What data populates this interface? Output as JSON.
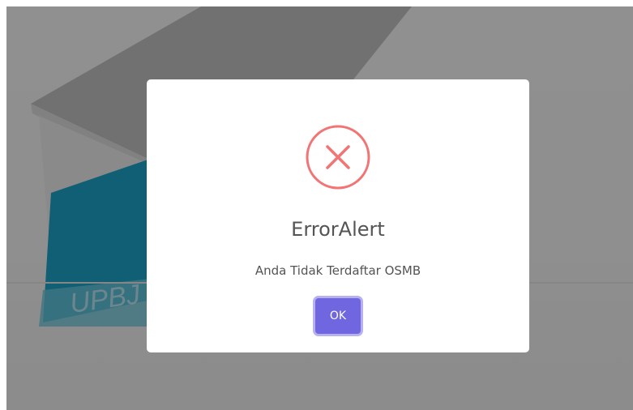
{
  "background": {
    "sign_text": "UPBJ"
  },
  "alert": {
    "title": "ErrorAlert",
    "message": "Anda Tidak Terdaftar OSMB",
    "confirm_label": "OK",
    "icon": "error-x-icon"
  },
  "colors": {
    "error": "#f27474",
    "confirm_button": "#7066e0",
    "text": "#545454"
  }
}
